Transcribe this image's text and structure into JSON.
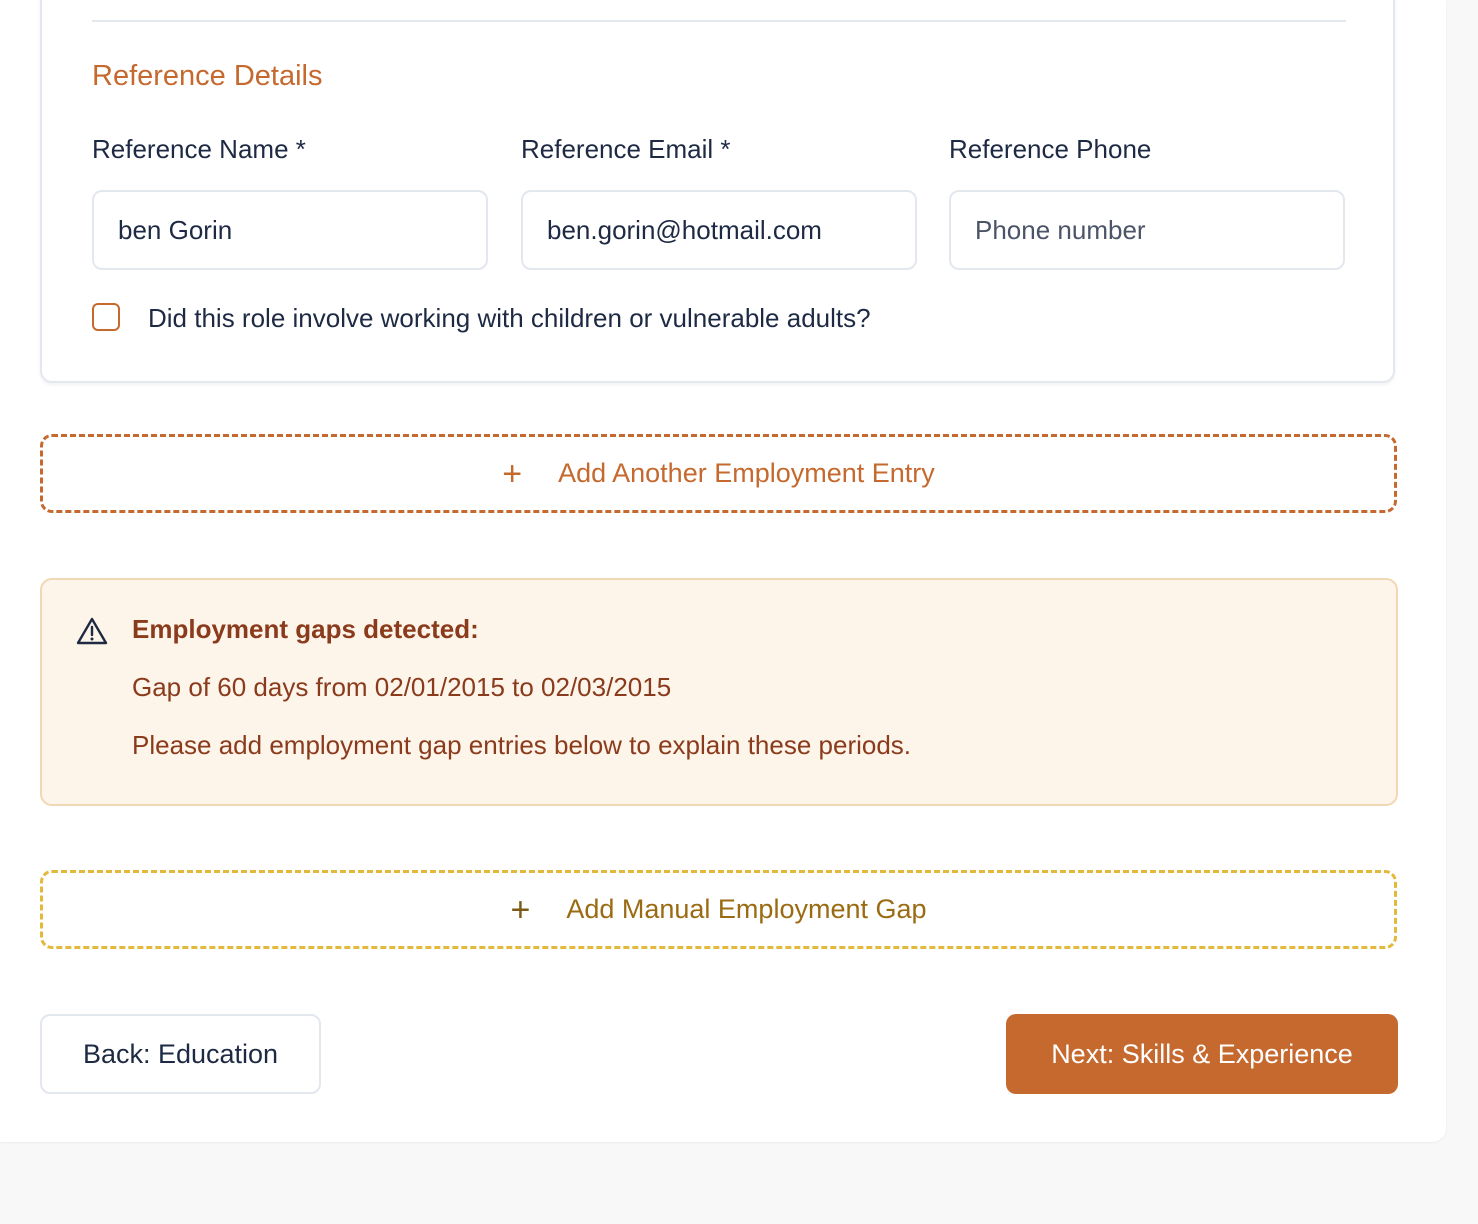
{
  "reference": {
    "section_title": "Reference Details",
    "name": {
      "label": "Reference Name *",
      "value": "ben Gorin"
    },
    "email": {
      "label": "Reference Email *",
      "value": "ben.gorin@hotmail.com"
    },
    "phone": {
      "label": "Reference Phone",
      "value": "",
      "placeholder": "Phone number"
    },
    "vulnerable_checkbox": {
      "label": "Did this role involve working with children or vulnerable adults?",
      "checked": false
    }
  },
  "add_employment": {
    "icon": "plus-icon",
    "label": "Add Another Employment Entry"
  },
  "gap_alert": {
    "icon": "warning-triangle-icon",
    "title": "Employment gaps detected:",
    "gap_line": "Gap of 60 days from 02/01/2015 to 02/03/2015",
    "instruction": "Please add employment gap entries below to explain these periods."
  },
  "add_gap": {
    "icon": "plus-icon",
    "label": "Add Manual Employment Gap"
  },
  "navigation": {
    "back_label": "Back: Education",
    "next_label": "Next: Skills & Experience"
  },
  "colors": {
    "accent": "#c5692e",
    "warning_text": "#8a3b1c",
    "warning_bg": "#fdf4ea",
    "gap_border": "#e2b93b",
    "text": "#1e2a44"
  }
}
